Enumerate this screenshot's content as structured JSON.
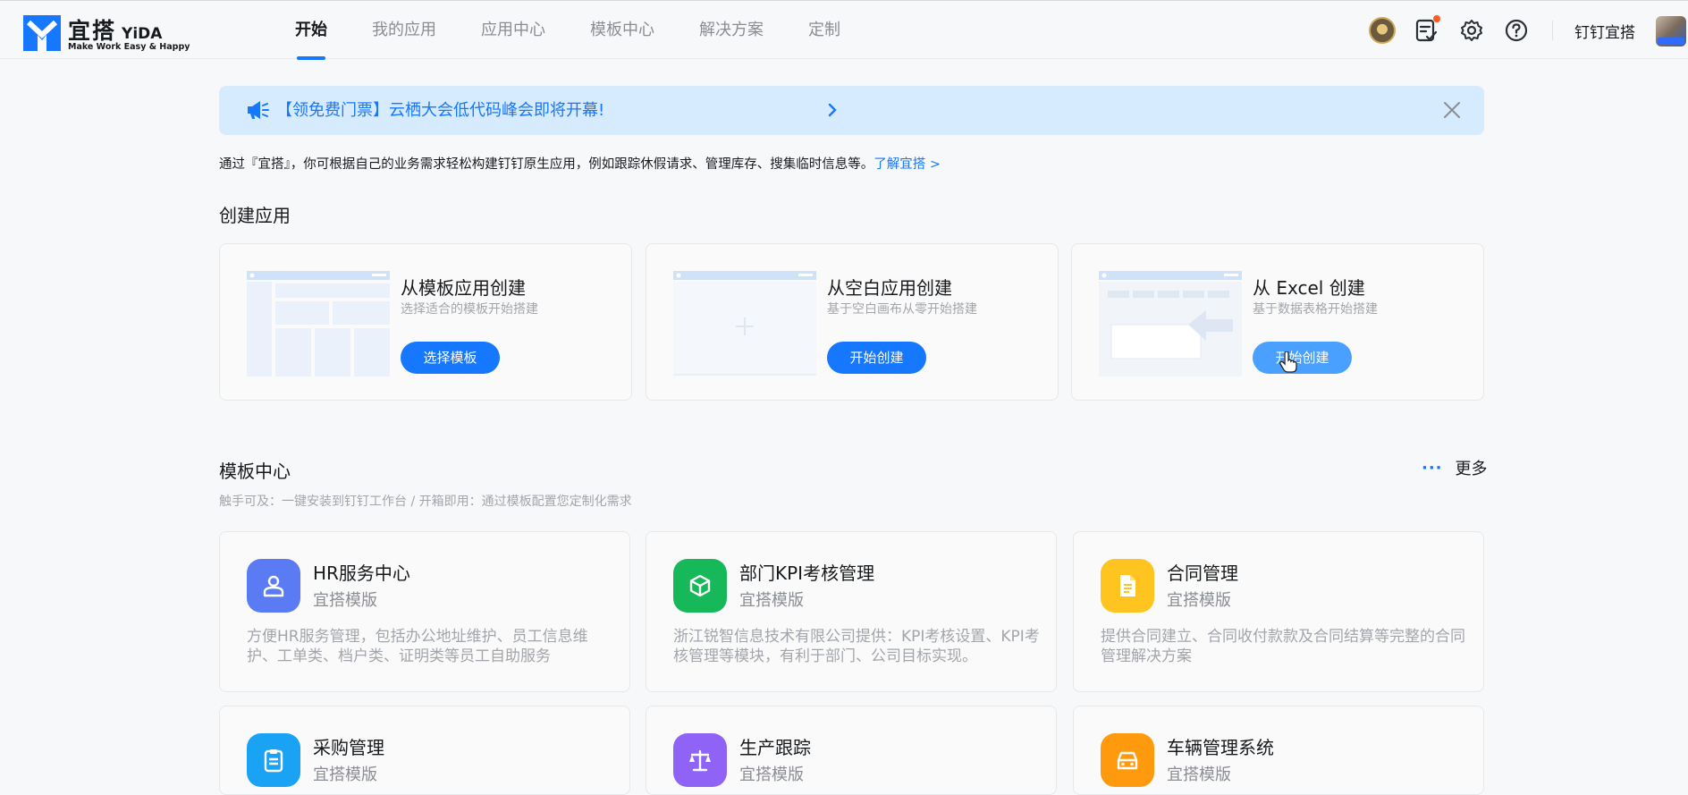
{
  "header": {
    "logo_cn": "宜搭",
    "logo_en": "YiDA",
    "logo_slogan": "Make Work Easy & Happy",
    "nav": [
      "开始",
      "我的应用",
      "应用中心",
      "模板中心",
      "解决方案",
      "定制"
    ],
    "active_nav": "开始",
    "user_name": "钉钉宜搭"
  },
  "banner": {
    "text": "【领免费门票】云栖大会低代码峰会即将开幕!"
  },
  "intro": {
    "text": "通过『宜搭』，你可根据自己的业务需求轻松构建钉钉原生应用，例如跟踪休假请求、管理库存、搜集临时信息等。",
    "link": "了解宜搭 >"
  },
  "create_section": {
    "title": "创建应用",
    "cards": [
      {
        "title": "从模板应用创建",
        "subtitle": "选择适合的模板开始搭建",
        "button": "选择模板"
      },
      {
        "title": "从空白应用创建",
        "subtitle": "基于空白画布从零开始搭建",
        "button": "开始创建"
      },
      {
        "title": "从 Excel 创建",
        "subtitle": "基于数据表格开始搭建",
        "button": "开始创建"
      }
    ]
  },
  "template_section": {
    "title": "模板中心",
    "more": "更多",
    "subtitle": "触手可及：一键安装到钉钉工作台 / 开箱即用：通过模板配置您定制化需求",
    "templates": [
      {
        "name": "HR服务中心",
        "tag": "宜搭模版",
        "desc": "方便HR服务管理，包括办公地址维护、员工信息维护、工单类、档户类、证明类等员工自助服务",
        "color": "#5b7bf5",
        "icon": "user-badge-icon"
      },
      {
        "name": "部门KPI考核管理",
        "tag": "宜搭模版",
        "desc": "浙江锐智信息技术有限公司提供：KPI考核设置、KPI考核管理等模块，有利于部门、公司目标实现。",
        "color": "#16b85a",
        "icon": "cube-icon"
      },
      {
        "name": "合同管理",
        "tag": "宜搭模版",
        "desc": "提供合同建立、合同收付款款及合同结算等完整的合同管理解决方案",
        "color": "#ffc41f",
        "icon": "document-icon"
      },
      {
        "name": "采购管理",
        "tag": "宜搭模版",
        "desc": "",
        "color": "#1aa3f5",
        "icon": "clipboard-icon"
      },
      {
        "name": "生产跟踪",
        "tag": "宜搭模版",
        "desc": "",
        "color": "#8e63f5",
        "icon": "scale-icon"
      },
      {
        "name": "车辆管理系统",
        "tag": "宜搭模版",
        "desc": "",
        "color": "#ff9a0e",
        "icon": "car-icon"
      }
    ]
  }
}
